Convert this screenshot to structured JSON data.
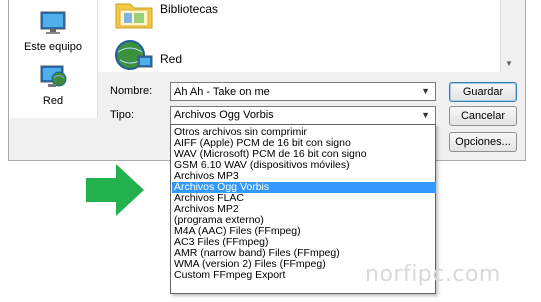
{
  "sidebar": {
    "items": [
      {
        "label": "Este equipo",
        "icon": "computer-icon"
      },
      {
        "label": "Red",
        "icon": "network-icon"
      }
    ]
  },
  "main": {
    "items": [
      {
        "label": "Bibliotecas",
        "icon": "folder-icon"
      },
      {
        "label": "Red",
        "icon": "network-globe-icon"
      }
    ]
  },
  "form": {
    "name_label": "Nombre:",
    "name_value": "Ah Ah - Take on me",
    "type_label": "Tipo:",
    "type_value": "Archivos Ogg Vorbis"
  },
  "buttons": {
    "save": "Guardar",
    "cancel": "Cancelar",
    "options": "Opciones..."
  },
  "dropdown": {
    "selected_index": 5,
    "options": [
      "Otros archivos sin comprimir",
      "AIFF (Apple) PCM de 16 bit con signo",
      "WAV (Microsoft) PCM de 16 bit con signo",
      "GSM 6.10 WAV (dispositivos móviles)",
      "Archivos MP3",
      "Archivos Ogg Vorbis",
      "Archivos FLAC",
      "Archivos MP2",
      "(programa externo)",
      "M4A (AAC) Files (FFmpeg)",
      "AC3 Files (FFmpeg)",
      "AMR (narrow band) Files (FFmpeg)",
      "WMA (version 2) Files (FFmpeg)",
      "Custom FFmpeg Export"
    ]
  },
  "watermark": "norfipc.com",
  "colors": {
    "selection": "#3399ff",
    "arrow": "#22b14c"
  }
}
